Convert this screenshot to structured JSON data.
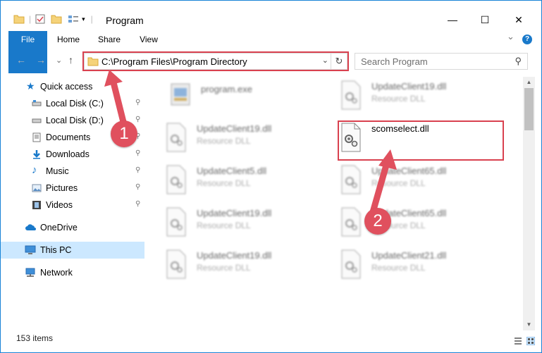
{
  "window": {
    "title": "Program",
    "minimize_glyph": "—",
    "maximize_glyph": "☐",
    "close_glyph": "✕"
  },
  "ribbon": {
    "tabs": [
      "File",
      "Home",
      "Share",
      "View"
    ],
    "expand_glyph": "⌄",
    "help_glyph": "?"
  },
  "address": {
    "back_glyph": "←",
    "forward_glyph": "→",
    "recent_glyph": "⌄",
    "up_glyph": "↑",
    "path": "C:\\Program Files\\Program Directory",
    "dropdown_glyph": "⌄",
    "refresh_glyph": "↻"
  },
  "search": {
    "placeholder": "Search Program",
    "icon": "search-icon",
    "icon_glyph": "⚲"
  },
  "nav": {
    "pin_glyph": "📌",
    "items": [
      {
        "label": "Quick access",
        "icon": "star-icon"
      },
      {
        "label": "Local Disk (C:)",
        "icon": "drive-icon",
        "pinned": true
      },
      {
        "label": "Local Disk (D:)",
        "icon": "drive-icon",
        "pinned": true
      },
      {
        "label": "Documents",
        "icon": "documents-icon",
        "pinned": true
      },
      {
        "label": "Downloads",
        "icon": "download-icon",
        "pinned": true
      },
      {
        "label": "Music",
        "icon": "music-icon",
        "pinned": true
      },
      {
        "label": "Pictures",
        "icon": "pictures-icon",
        "pinned": true
      },
      {
        "label": "Videos",
        "icon": "videos-icon",
        "pinned": true
      },
      {
        "label": "OneDrive",
        "icon": "cloud-icon"
      },
      {
        "label": "This PC",
        "icon": "computer-icon",
        "selected": true
      },
      {
        "label": "Network",
        "icon": "network-icon"
      }
    ]
  },
  "files": [
    {
      "name": "program.exe",
      "type": ""
    },
    {
      "name": "UpdateClient19.dll",
      "type": "Resource DLL"
    },
    {
      "name": "UpdateClient19.dll",
      "type": "Resource DLL"
    },
    {
      "name": "scomselect.dll",
      "type": ""
    },
    {
      "name": "UpdateClient5.dll",
      "type": "Resource DLL"
    },
    {
      "name": "UpdateClient65.dll",
      "type": "Resource DLL"
    },
    {
      "name": "UpdateClient19.dll",
      "type": "Resource DLL"
    },
    {
      "name": "UpdateClient65.dll",
      "type": "Resource DLL"
    },
    {
      "name": "UpdateClient19.dll",
      "type": "Resource DLL"
    },
    {
      "name": "UpdateClient21.dll",
      "type": "Resource DLL"
    }
  ],
  "scrollbar": {
    "up_glyph": "▲",
    "down_glyph": "▼"
  },
  "status": {
    "items_count": "153 items"
  },
  "callouts": {
    "one": "1",
    "two": "2"
  },
  "colors": {
    "accent": "#1979ca",
    "highlight": "#d9414f",
    "selected": "#cce8ff"
  }
}
